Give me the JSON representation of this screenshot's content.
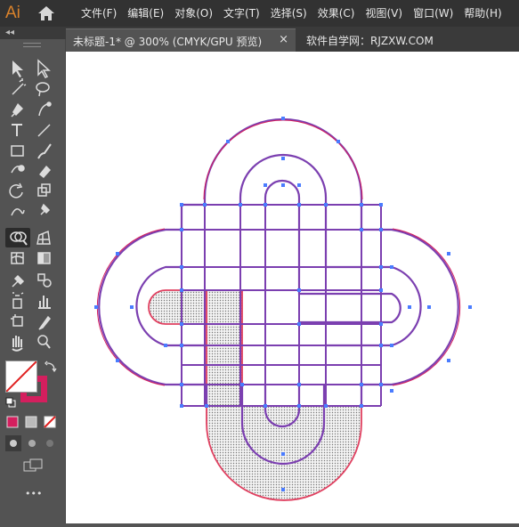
{
  "app": {
    "logo": "Ai",
    "home_icon": "home-icon"
  },
  "menu": [
    "文件(F)",
    "编辑(E)",
    "对象(O)",
    "文字(T)",
    "选择(S)",
    "效果(C)",
    "视图(V)",
    "窗口(W)",
    "帮助(H)"
  ],
  "tabs": {
    "active_title": "未标题-1* @ 300% (CMYK/GPU 预览)",
    "close_glyph": "×",
    "other_title": "软件自学网：RJZXW.COM"
  },
  "toolbar": {
    "collapse_glyph": "◂◂",
    "more_glyph": "•••",
    "tools": [
      "selection-tool",
      "direct-selection-tool",
      "pen-tool",
      "curvature-tool",
      "type-tool",
      "line-tool",
      "rectangle-tool",
      "paintbrush-tool",
      "shaper-tool",
      "eraser-tool",
      "rotate-tool",
      "scale-tool",
      "warp-tool",
      "free-transform-tool",
      "shape-builder-tool",
      "perspective-grid-tool",
      "mesh-tool",
      "gradient-tool",
      "eyedropper-tool",
      "blend-tool",
      "symbol-sprayer-tool",
      "column-graph-tool",
      "artboard-tool",
      "slice-tool",
      "hand-tool",
      "zoom-tool"
    ],
    "active_tool": "shape-builder-tool"
  },
  "colors": {
    "stroke": "#d41f5e",
    "path": "#7b3fb0",
    "anchor": "#4a7cff",
    "canvas": "#ffffff",
    "ui_dark": "#323232",
    "ui_panel": "#535353"
  }
}
